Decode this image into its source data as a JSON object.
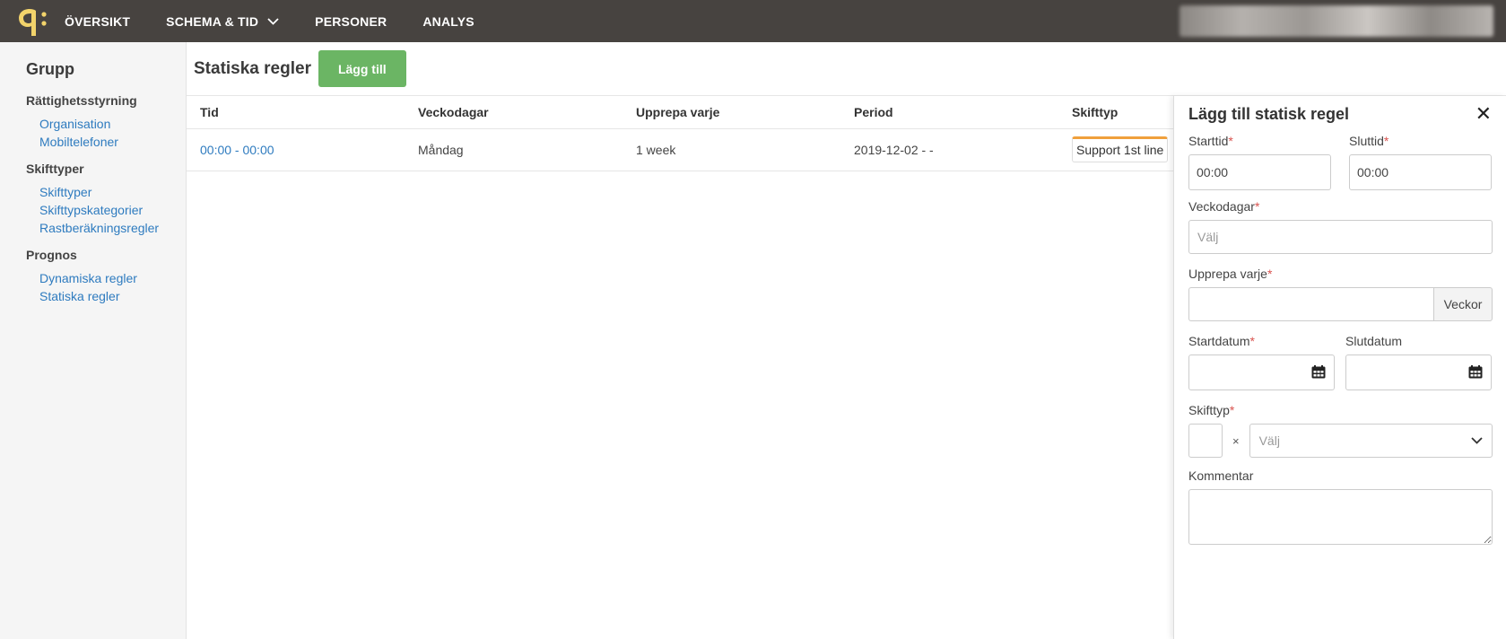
{
  "nav": {
    "items": [
      {
        "label": "ÖVERSIKT"
      },
      {
        "label": "SCHEMA & TID"
      },
      {
        "label": "PERSONER"
      },
      {
        "label": "ANALYS"
      }
    ]
  },
  "sidebar": {
    "title": "Grupp",
    "sections": [
      {
        "label": "Rättighetsstyrning",
        "links": [
          "Organisation",
          "Mobiltelefoner"
        ]
      },
      {
        "label": "Skifttyper",
        "links": [
          "Skifttyper",
          "Skifttypskategorier",
          "Rastberäkningsregler"
        ]
      },
      {
        "label": "Prognos",
        "links": [
          "Dynamiska regler",
          "Statiska regler"
        ]
      }
    ]
  },
  "main": {
    "title": "Statiska regler",
    "add_label": "Lägg till",
    "table": {
      "headers": [
        "Tid",
        "Veckodagar",
        "Upprepa varje",
        "Period",
        "Skifttyp"
      ],
      "rows": [
        {
          "time": "00:00 - 00:00",
          "days": "Måndag",
          "repeat": "1 week",
          "period": "2019-12-02 - -",
          "shift": "Support 1st line"
        }
      ]
    }
  },
  "panel": {
    "title": "Lägg till statisk regel",
    "starttid_label": "Starttid",
    "starttid_value": "00:00",
    "sluttid_label": "Sluttid",
    "sluttid_value": "00:00",
    "veckodagar_label": "Veckodagar",
    "veckodagar_placeholder": "Välj",
    "upprepa_label": "Upprepa varje",
    "upprepa_value": "",
    "upprepa_unit": "Veckor",
    "startdatum_label": "Startdatum",
    "slutdatum_label": "Slutdatum",
    "skifttyp_label": "Skifttyp",
    "skifttyp_times": "×",
    "skifttyp_placeholder": "Välj",
    "kommentar_label": "Kommentar",
    "required_mark": "*"
  },
  "colors": {
    "topbar": "#474340",
    "logo": "#f2d36b",
    "link": "#2e7bbf",
    "add_button": "#6bb564",
    "shift_accent": "#f0a03c",
    "required": "#d9534f"
  }
}
